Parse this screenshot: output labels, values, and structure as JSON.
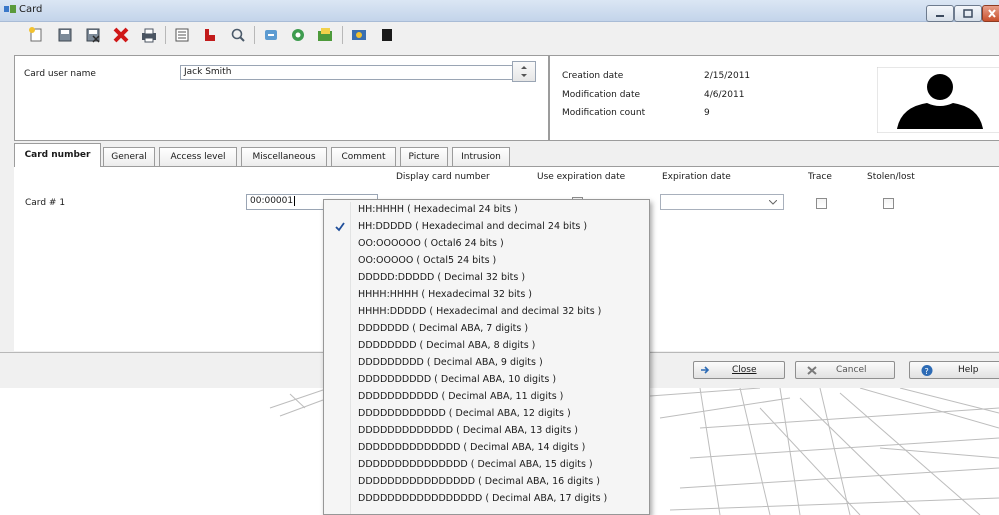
{
  "window": {
    "title": "Card"
  },
  "header": {
    "card_user_name_label": "Card user name",
    "card_user_name_value": "Jack Smith",
    "creation_date_label": "Creation date",
    "creation_date_value": "2/15/2011",
    "modification_date_label": "Modification date",
    "modification_date_value": "4/6/2011",
    "modification_count_label": "Modification count",
    "modification_count_value": "9"
  },
  "tabs": [
    {
      "label": "Card number",
      "active": true
    },
    {
      "label": "General"
    },
    {
      "label": "Access level"
    },
    {
      "label": "Miscellaneous"
    },
    {
      "label": "Comment"
    },
    {
      "label": "Picture"
    },
    {
      "label": "Intrusion"
    }
  ],
  "card_number_tab": {
    "headers": {
      "display_card_number": "Display card number",
      "use_expiration_date": "Use expiration date",
      "expiration_date": "Expiration date",
      "trace": "Trace",
      "stolen_lost": "Stolen/lost"
    },
    "row_label": "Card # 1",
    "card_number_value": "00:00001"
  },
  "buttons": {
    "close": "Close",
    "cancel": "Cancel",
    "help": "Help"
  },
  "format_menu": {
    "selected_index": 1,
    "items": [
      "HH:HHHH  ( Hexadecimal 24 bits )",
      "HH:DDDDD  ( Hexadecimal and decimal 24 bits )",
      "OO:OOOOOO  ( Octal6 24 bits )",
      "OO:OOOOO  ( Octal5 24 bits )",
      "DDDDD:DDDDD  ( Decimal 32 bits )",
      "HHHH:HHHH  ( Hexadecimal 32 bits )",
      "HHHH:DDDDD  ( Hexadecimal and decimal 32 bits )",
      "DDDDDDD  ( Decimal ABA, 7 digits )",
      "DDDDDDDD  ( Decimal ABA, 8 digits )",
      "DDDDDDDDD  ( Decimal ABA, 9 digits )",
      "DDDDDDDDDD  ( Decimal ABA, 10 digits )",
      "DDDDDDDDDDD  ( Decimal ABA, 11 digits )",
      "DDDDDDDDDDDD  ( Decimal ABA, 12 digits )",
      "DDDDDDDDDDDDD  ( Decimal ABA, 13 digits )",
      "DDDDDDDDDDDDDD  ( Decimal ABA, 14 digits )",
      "DDDDDDDDDDDDDDD  ( Decimal ABA, 15 digits )",
      "DDDDDDDDDDDDDDDD  ( Decimal ABA, 16 digits )",
      "DDDDDDDDDDDDDDDDD  ( Decimal ABA, 17 digits )"
    ]
  },
  "toolbar": {
    "icons": [
      "new-icon",
      "save-icon",
      "save-close-icon",
      "delete-icon",
      "print-icon",
      "list-icon",
      "filter-icon",
      "search-icon",
      "export-icon",
      "view-icon",
      "import-icon",
      "photo-icon",
      "black-square-icon"
    ]
  },
  "colors": {
    "title_bar": "#c3d4ea",
    "menu_check": "#1f4e9a",
    "close_button": "#c8502c"
  }
}
